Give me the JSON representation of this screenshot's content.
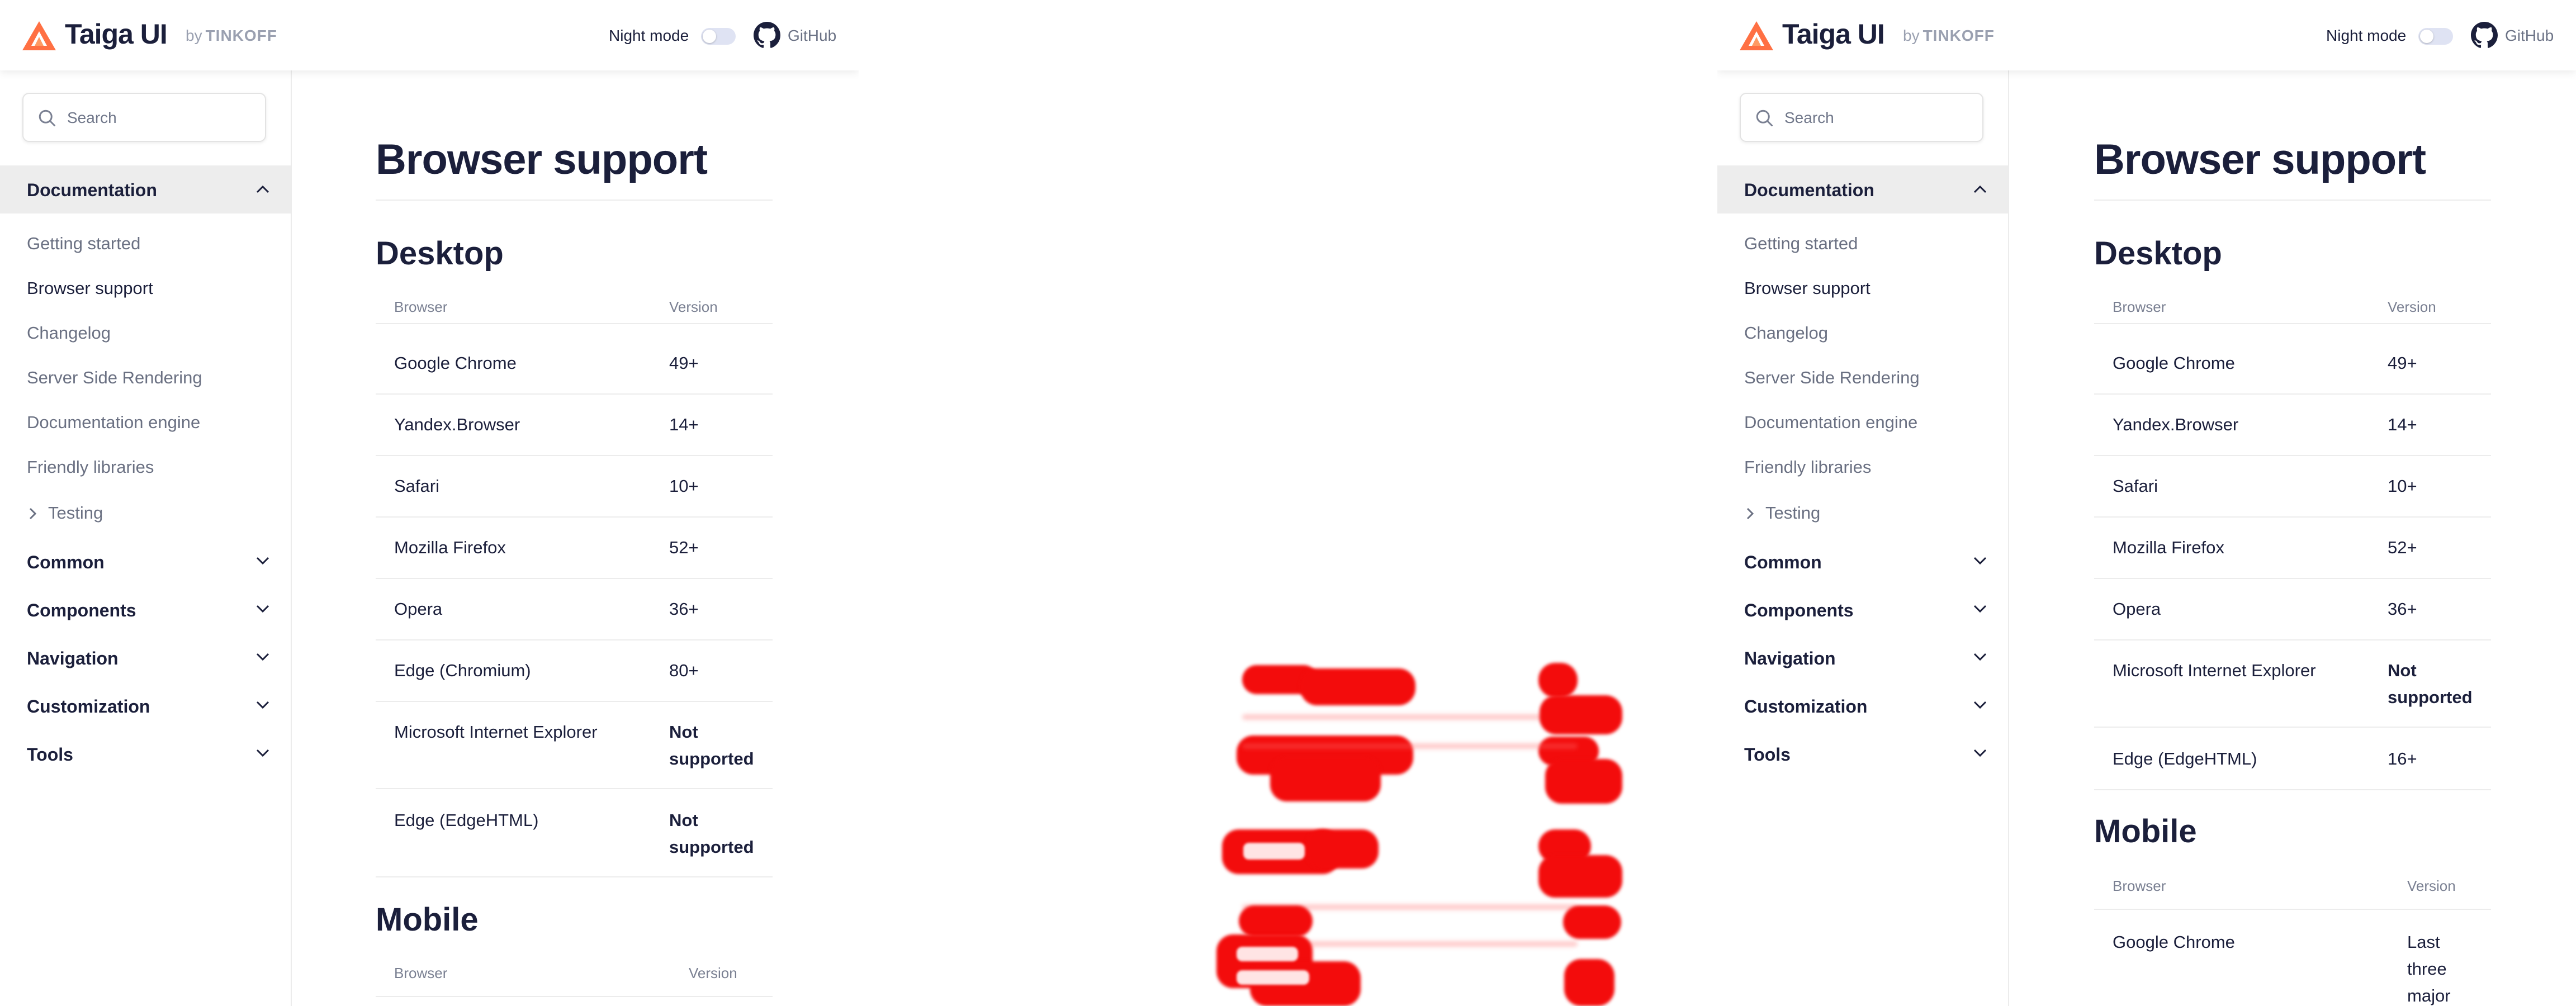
{
  "header": {
    "brand": "Taiga UI",
    "by": "by",
    "company": "TINKOFF",
    "night_mode_label": "Night mode",
    "github_label": "GitHub"
  },
  "sidebar": {
    "search_placeholder": "Search",
    "sections": [
      {
        "label": "Documentation",
        "expanded": true
      },
      {
        "label": "Common",
        "expanded": false
      },
      {
        "label": "Components",
        "expanded": false
      },
      {
        "label": "Navigation",
        "expanded": false
      },
      {
        "label": "Customization",
        "expanded": false
      },
      {
        "label": "Tools",
        "expanded": false
      }
    ],
    "doc_items": [
      {
        "label": "Getting started"
      },
      {
        "label": "Browser support",
        "active": true
      },
      {
        "label": "Changelog"
      },
      {
        "label": "Server Side Rendering"
      },
      {
        "label": "Documentation engine"
      },
      {
        "label": "Friendly libraries"
      }
    ],
    "testing_label": "Testing"
  },
  "content": {
    "title": "Browser support",
    "desktop_title": "Desktop",
    "mobile_title": "Mobile",
    "col_browser": "Browser",
    "col_version": "Version"
  },
  "left_panel": {
    "desktop_rows": [
      {
        "browser": "Google Chrome",
        "version": "49+"
      },
      {
        "browser": "Yandex.Browser",
        "version": "14+"
      },
      {
        "browser": "Safari",
        "version": "10+"
      },
      {
        "browser": "Mozilla Firefox",
        "version": "52+"
      },
      {
        "browser": "Opera",
        "version": "36+"
      },
      {
        "browser": "Edge (Chromium)",
        "version": "80+"
      },
      {
        "browser": "Microsoft Internet Explorer",
        "version_l1": "Not",
        "version_l2": "supported"
      },
      {
        "browser": "Edge (EdgeHTML)",
        "version_l1": "Not",
        "version_l2": "supported"
      }
    ]
  },
  "right_panel": {
    "desktop_rows": [
      {
        "browser": "Google Chrome",
        "version": "49+"
      },
      {
        "browser": "Yandex.Browser",
        "version": "14+"
      },
      {
        "browser": "Safari",
        "version": "10+"
      },
      {
        "browser": "Mozilla Firefox",
        "version": "52+"
      },
      {
        "browser": "Opera",
        "version": "36+"
      },
      {
        "browser": "Microsoft Internet Explorer",
        "version_l1": "Not",
        "version_l2": "supported"
      },
      {
        "browser": "Edge (EdgeHTML)",
        "version": "16+"
      }
    ],
    "mobile_rows": [
      {
        "browser": "Google Chrome",
        "version_l1": "Last",
        "version_l2": "three",
        "version_l3": "major"
      }
    ]
  },
  "colors": {
    "accent": "#ff7043",
    "text": "#1b1f3b",
    "muted": "#6a7082",
    "redaction": "#f30c0c"
  },
  "icons": [
    "taiga-logo-icon",
    "github-icon",
    "search-icon",
    "chevron-up-icon",
    "chevron-down-icon",
    "chevron-right-icon"
  ]
}
